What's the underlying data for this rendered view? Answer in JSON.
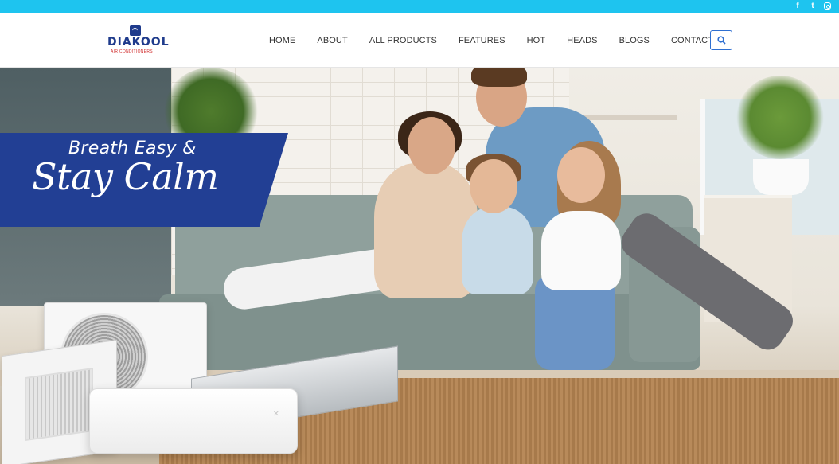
{
  "topbar": {
    "social": [
      {
        "icon": "facebook-icon",
        "glyph": "f"
      },
      {
        "icon": "twitter-icon",
        "glyph": "t"
      },
      {
        "icon": "instagram-icon",
        "glyph": ""
      }
    ],
    "color": "#1ec4ef"
  },
  "header": {
    "logo": {
      "brand": "DIAKOOL",
      "tagline": "AIR CONDITIONERS"
    },
    "nav": [
      "HOME",
      "ABOUT",
      "ALL PRODUCTS",
      "FEATURES",
      "HOT",
      "HEADS",
      "BLOGS",
      "CONTACT US"
    ],
    "search_icon": "search-icon"
  },
  "hero": {
    "headline_line1": "Breath Easy &",
    "headline_line2": "Stay Calm",
    "band_color": "#223f94"
  }
}
